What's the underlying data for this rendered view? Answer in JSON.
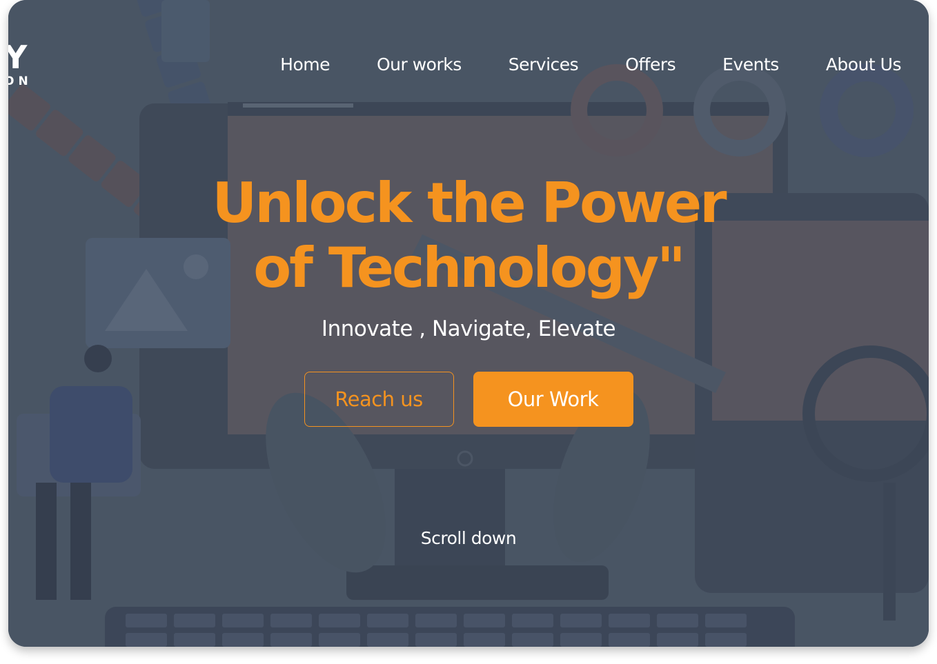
{
  "brand": {
    "logo_main": "Y",
    "logo_sub": "ON"
  },
  "nav": {
    "items": [
      {
        "label": "Home"
      },
      {
        "label": "Our works"
      },
      {
        "label": "Services"
      },
      {
        "label": "Offers"
      },
      {
        "label": "Events"
      },
      {
        "label": "About Us"
      }
    ]
  },
  "hero": {
    "title_line1": "Unlock the Power",
    "title_line2": "of Technology\"",
    "tagline": "Innovate , Navigate, Elevate"
  },
  "buttons": {
    "reach_us": "Reach us",
    "our_work": "Our Work"
  },
  "scroll_label": "Scroll down",
  "colors": {
    "accent": "#f5931f",
    "background": "#4a5565",
    "text": "#ffffff"
  },
  "background_image": {
    "icon_names": [
      "color-swatch-fan",
      "monitor-icon",
      "magnifier-icon",
      "gear-icon",
      "image-icon",
      "donut-chart-icon",
      "keyboard-icon",
      "person-figure"
    ]
  }
}
